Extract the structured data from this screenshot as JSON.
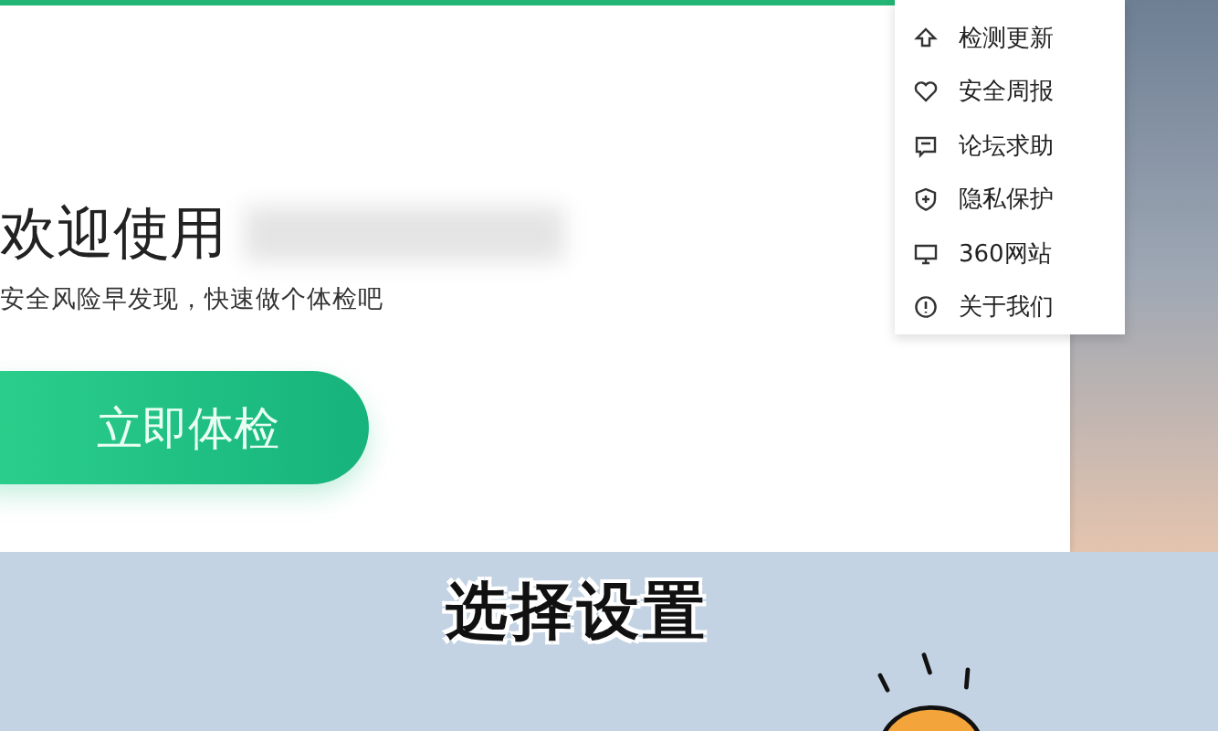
{
  "welcome": {
    "title": "欢迎使用",
    "subtitle": "安全风险早发现，快速做个体检吧",
    "button": "立即体检"
  },
  "menu": {
    "items": [
      {
        "label": "检测更新"
      },
      {
        "label": "安全周报"
      },
      {
        "label": "论坛求助"
      },
      {
        "label": "隐私保护"
      },
      {
        "label": "360网站"
      },
      {
        "label": "关于我们"
      }
    ]
  },
  "caption": "选择设置"
}
